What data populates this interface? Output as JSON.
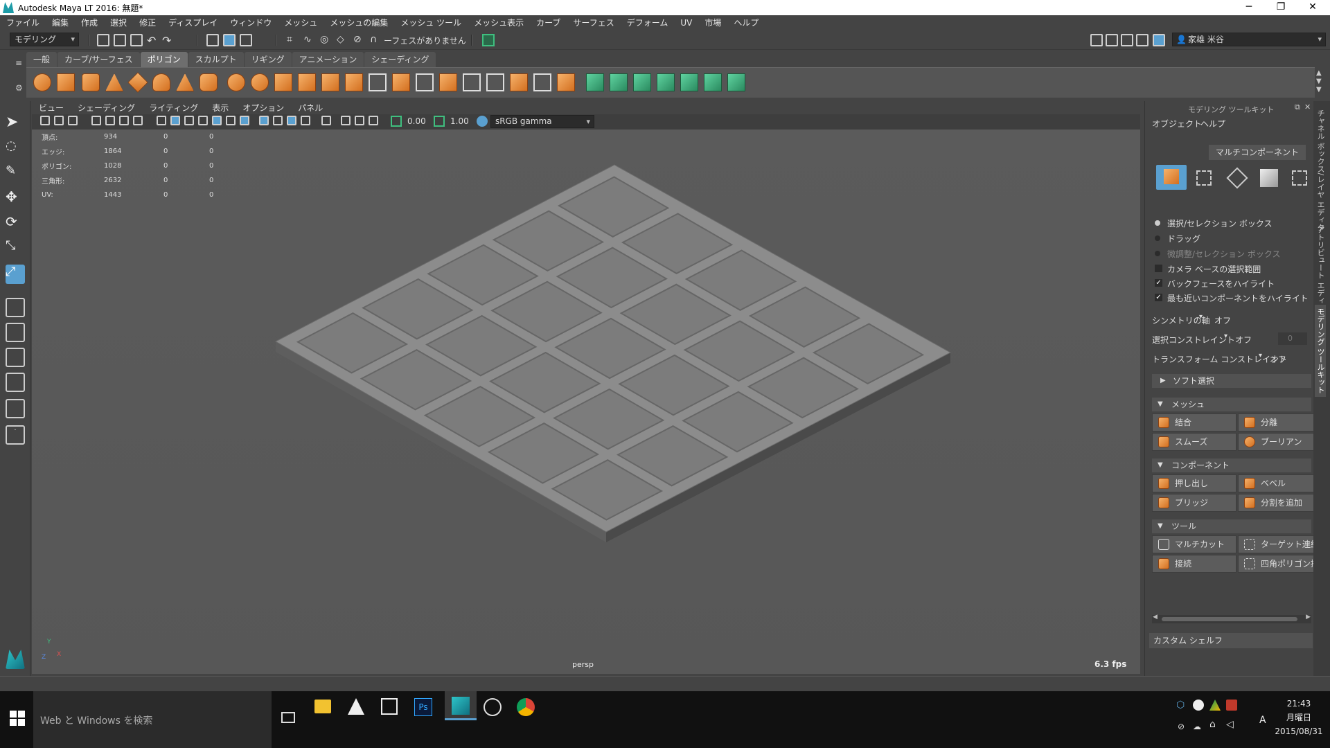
{
  "window": {
    "title": "Autodesk Maya LT 2016: 無題*"
  },
  "menu": [
    "ファイル",
    "編集",
    "作成",
    "選択",
    "修正",
    "ディスプレイ",
    "ウィンドウ",
    "メッシュ",
    "メッシュの編集",
    "メッシュ ツール",
    "メッシュ表示",
    "カーブ",
    "サーフェス",
    "デフォーム",
    "UV",
    "市場",
    "ヘルプ"
  ],
  "statusline": {
    "mode": "モデリング",
    "no_faces": "ーフェスがありません",
    "user": "家雄 米谷"
  },
  "shelf_tabs": [
    "一般",
    "カーブ/サーフェス",
    "ポリゴン",
    "スカルプト",
    "リギング",
    "アニメーション",
    "シェーディング"
  ],
  "active_shelf_tab": "ポリゴン",
  "viewport": {
    "menu": [
      "ビュー",
      "シェーディング",
      "ライティング",
      "表示",
      "オプション",
      "パネル"
    ],
    "near": "0.00",
    "far": "1.00",
    "colorspace": "sRGB gamma",
    "camera": "persp",
    "fps": "6.3 fps",
    "axis_y": "Y",
    "axis_x": "X",
    "axis_z": "Z"
  },
  "hud": [
    {
      "label": "頂点:",
      "v1": "934",
      "v2": "0",
      "v3": "0"
    },
    {
      "label": "エッジ:",
      "v1": "1864",
      "v2": "0",
      "v3": "0"
    },
    {
      "label": "ポリゴン:",
      "v1": "1028",
      "v2": "0",
      "v3": "0"
    },
    {
      "label": "三角形:",
      "v1": "2632",
      "v2": "0",
      "v3": "0"
    },
    {
      "label": "UV:",
      "v1": "1443",
      "v2": "0",
      "v3": "0"
    }
  ],
  "toolkit": {
    "title": "モデリング ツールキット",
    "menu": [
      "オブジェクト",
      "ヘルプ"
    ],
    "multi": "マルチコンポーネント",
    "options": [
      "選択/セレクション ボックス",
      "ドラッグ",
      "微調整/セレクション ボックス"
    ],
    "checks": [
      "カメラ ベースの選択範囲",
      "バックフェースをハイライト",
      "最も近いコンポーネントをハイライト"
    ],
    "sym_label": "シンメトリの軸",
    "sym_val": "オフ",
    "sel_label": "選択コンストレイント",
    "sel_val": "オフ",
    "sel_num": "0",
    "xf_label": "トランスフォーム コンストレイント",
    "xf_val": "オフ",
    "soft": "ソフト選択",
    "mesh_sec": "メッシュ",
    "mesh_btns": [
      "結合",
      "分離",
      "スムーズ",
      "ブーリアン"
    ],
    "comp_sec": "コンポーネント",
    "comp_btns": [
      "押し出し",
      "ベベル",
      "ブリッジ",
      "分割を追加"
    ],
    "tool_sec": "ツール",
    "tool_btns": [
      "マルチカット",
      "ターゲット連結",
      "接続",
      "四角ポリゴン描画"
    ],
    "custom": "カスタム シェルフ"
  },
  "side_tabs": [
    "チャネル ボックス/レイヤ エディタ",
    "アトリビュート エディタ",
    "モデリング ツールキット"
  ],
  "taskbar": {
    "search": "Web と Windows を検索",
    "time": "21:43",
    "day": "月曜日",
    "date": "2015/08/31",
    "ime": "A"
  },
  "colors": {
    "accent_orange": "#e08a3c",
    "highlight_blue": "#5aa0d0",
    "green_icon": "#3fbf7f"
  }
}
